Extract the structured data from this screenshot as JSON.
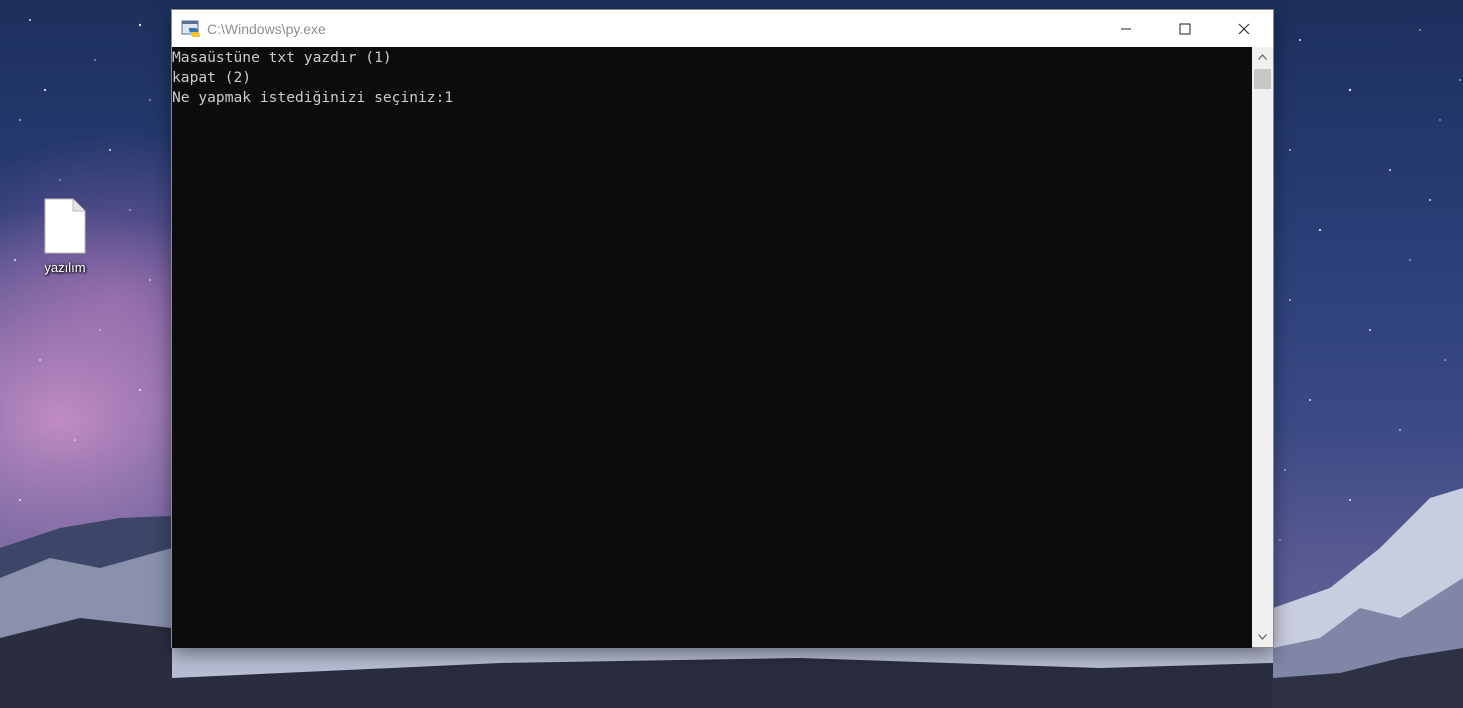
{
  "desktop": {
    "icons": [
      {
        "label": "yazılım",
        "icon": "text-file-icon"
      }
    ]
  },
  "window": {
    "title": "C:\\Windows\\py.exe",
    "icon": "python-launcher-icon",
    "controls": {
      "minimize": "minimize-icon",
      "maximize": "maximize-icon",
      "close": "close-icon"
    }
  },
  "console": {
    "lines": [
      "Masaüstüne txt yazdır (1)",
      "kapat (2)",
      "Ne yapmak istediğinizi seçiniz:1"
    ],
    "background": "#0c0c0c",
    "foreground": "#cccccc"
  }
}
